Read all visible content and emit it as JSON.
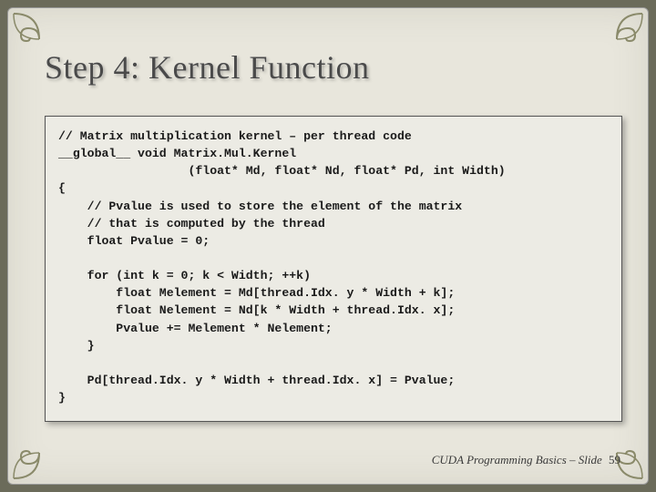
{
  "title": "Step 4: Kernel Function",
  "code_lines": [
    "// Matrix multiplication kernel – per thread code",
    "__global__ void Matrix.Mul.Kernel",
    "                  (float* Md, float* Nd, float* Pd, int Width)",
    "{",
    "    // Pvalue is used to store the element of the matrix",
    "    // that is computed by the thread",
    "    float Pvalue = 0;",
    "",
    "    for (int k = 0; k < Width; ++k)",
    "        float Melement = Md[thread.Idx. y * Width + k];",
    "        float Nelement = Nd[k * Width + thread.Idx. x];",
    "        Pvalue += Melement * Nelement;",
    "    }",
    "",
    "    Pd[thread.Idx. y * Width + thread.Idx. x] = Pvalue;",
    "}"
  ],
  "footer": {
    "text": "CUDA Programming Basics – Slide",
    "number": "59"
  },
  "colors": {
    "background_outer": "#6b6b5a",
    "slide_bg": "#e8e6dc",
    "code_bg": "#ecebe4",
    "swirl": "#8a8a6a"
  }
}
